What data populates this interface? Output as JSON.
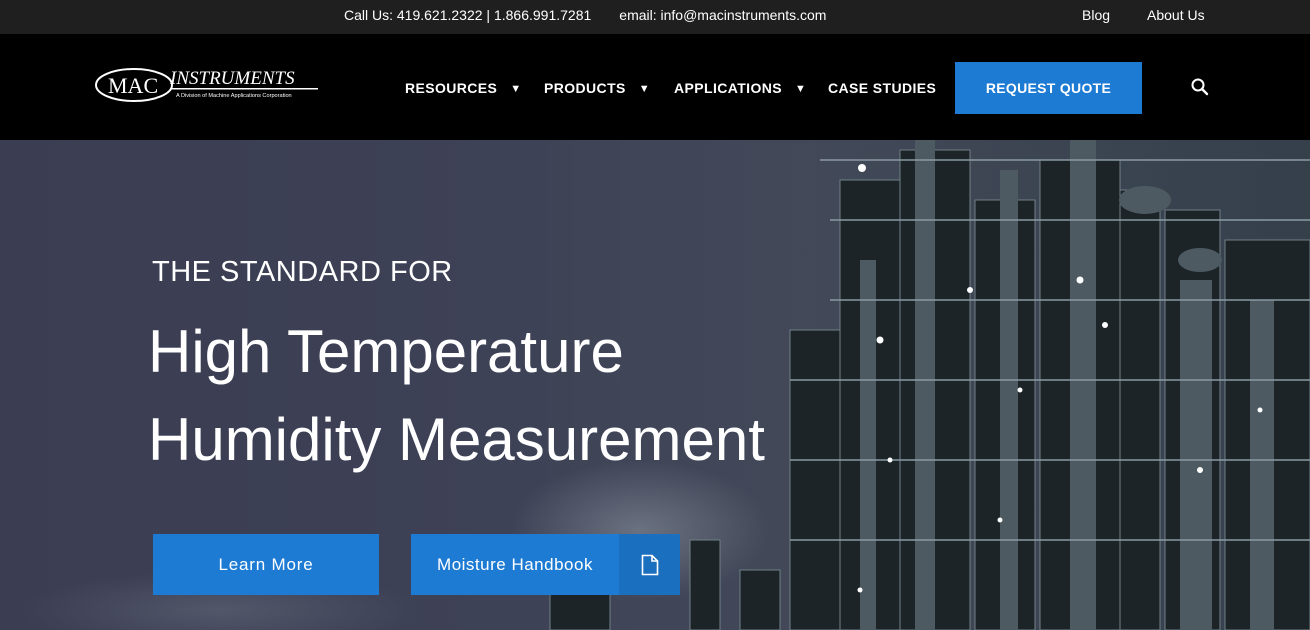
{
  "topbar": {
    "phone": "Call Us: 419.621.2322 | 1.866.991.7281",
    "email": "email: info@macinstruments.com",
    "blog": "Blog",
    "about": "About Us"
  },
  "logo": {
    "mark": "MAC",
    "name": "INSTRUMENTS",
    "tagline": "A Division of Machine Applications Corporation"
  },
  "nav": {
    "resources": "RESOURCES",
    "products": "PRODUCTS",
    "applications": "APPLICATIONS",
    "case_studies": "CASE STUDIES",
    "caret": "▼",
    "request_quote": "REQUEST QUOTE"
  },
  "hero": {
    "eyebrow": "THE STANDARD FOR",
    "title_line1": "High Temperature",
    "title_line2": "Humidity Measurement",
    "learn_more": "Learn More",
    "handbook": "Moisture Handbook"
  },
  "icons": {
    "search": "search-icon",
    "document": "document-icon",
    "caret": "caret-down-icon"
  },
  "colors": {
    "accent": "#1e7bd3",
    "topbar_bg": "#1f1f1f",
    "nav_bg": "#000000"
  }
}
